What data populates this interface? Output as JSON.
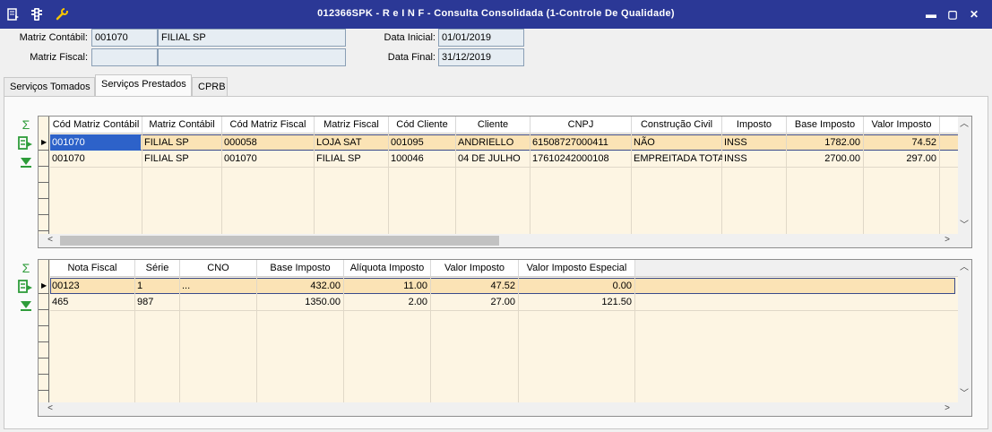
{
  "window": {
    "title": "012366SPK - R e I N F - Consulta Consolidada (1-Controle De Qualidade)",
    "icons": [
      "report-icon",
      "traffic-light-icon",
      "wrench-icon"
    ],
    "buttons": {
      "minimize": "▬",
      "maximize": "▢",
      "close": "✕"
    }
  },
  "header": {
    "matriz_contabil": {
      "label": "Matriz Contábil:",
      "code": "001070",
      "name": "FILIAL SP"
    },
    "matriz_fiscal": {
      "label": "Matriz Fiscal:",
      "code": "",
      "name": ""
    },
    "data_inicial": {
      "label": "Data Inicial:",
      "value": "01/01/2019"
    },
    "data_final": {
      "label": "Data Final:",
      "value": "31/12/2019"
    }
  },
  "tabs": [
    {
      "label": "Serviços Tomados"
    },
    {
      "label": "Serviços Prestados",
      "active": true
    },
    {
      "label": "CPRB"
    }
  ],
  "grid1": {
    "columns": [
      "Cód Matriz Contábil",
      "Matriz Contábil",
      "Cód Matriz Fiscal",
      "Matriz Fiscal",
      "Cód Cliente",
      "Cliente",
      "CNPJ",
      "Construção Civil",
      "Imposto",
      "Base Imposto",
      "Valor Imposto"
    ],
    "rows": [
      [
        "001070",
        "FILIAL SP",
        "000058",
        "LOJA SAT",
        "001095",
        "ANDRIELLO",
        "61508727000411",
        "NÃO",
        "INSS",
        "1782.00",
        "74.52"
      ],
      [
        "001070",
        "FILIAL SP",
        "001070",
        "FILIAL SP",
        "100046",
        "04 DE JULHO",
        "17610242000108",
        "EMPREITADA TOTAL",
        "INSS",
        "2700.00",
        "297.00"
      ]
    ]
  },
  "grid2": {
    "columns": [
      "Nota Fiscal",
      "Série",
      "CNO",
      "Base Imposto",
      "Alíquota Imposto",
      "Valor Imposto",
      "Valor Imposto Especial"
    ],
    "rows": [
      [
        "00123",
        "1",
        "...",
        "432.00",
        "11.00",
        "47.52",
        "0.00"
      ],
      [
        "465",
        "987",
        "",
        "1350.00",
        "2.00",
        "27.00",
        "121.50"
      ]
    ]
  },
  "side_buttons": {
    "sum": "Σ",
    "export": "⇨",
    "filter": "▼"
  },
  "scroll": {
    "left": "<",
    "right": ">",
    "up": "︿",
    "down": "﹀"
  },
  "colors": {
    "titlebar": "#2b3896",
    "selected_row": "#fbe3b5",
    "grid_bg": "#fdf5e3",
    "active_cell": "#2d62c9",
    "icon_green": "#2e9c3a"
  }
}
